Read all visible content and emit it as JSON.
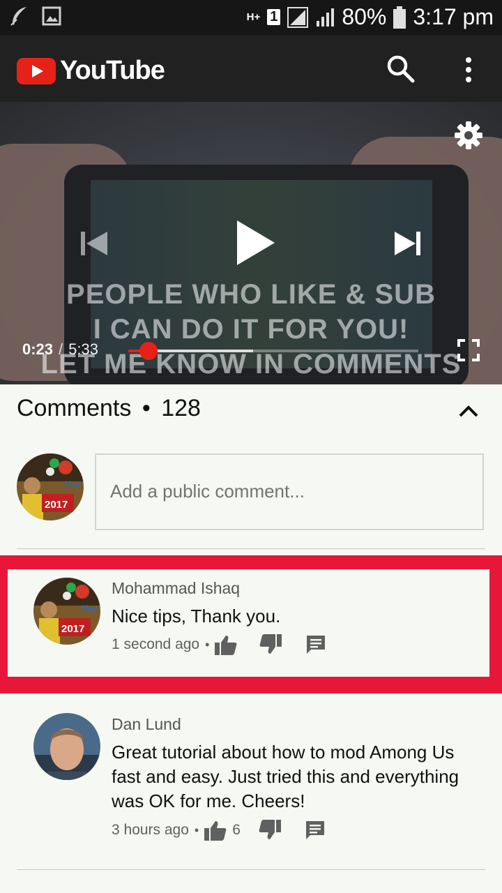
{
  "status_bar": {
    "network": "H+",
    "sim": "1",
    "battery": "80%",
    "time": "3:17 pm"
  },
  "app_bar": {
    "logo_text": "YouTube",
    "brand_color": "#e62117"
  },
  "player": {
    "overlay_lines": [
      "PEOPLE WHO LIKE & SUB",
      "I CAN DO IT FOR YOU!",
      "LET ME KNOW IN COMMENTS"
    ],
    "current_time": "0:23",
    "separator": "/",
    "duration": "5:33",
    "progress_fraction": 0.069,
    "buffered_fraction": 0.43
  },
  "comments": {
    "title": "Comments",
    "dot": "•",
    "count": "128",
    "add_placeholder": "Add a public comment...",
    "items": [
      {
        "author": "Mohammad Ishaq",
        "text": "Nice tips, Thank you.",
        "time": "1 second ago",
        "likes": ""
      },
      {
        "author": "Dan Lund",
        "text": "Great tutorial about how to mod Among Us fast and easy. Just tried this and everything was OK for me. Cheers!",
        "time": "3 hours ago",
        "likes": "6"
      }
    ],
    "badge_year": "2017",
    "badge_word": "New"
  }
}
